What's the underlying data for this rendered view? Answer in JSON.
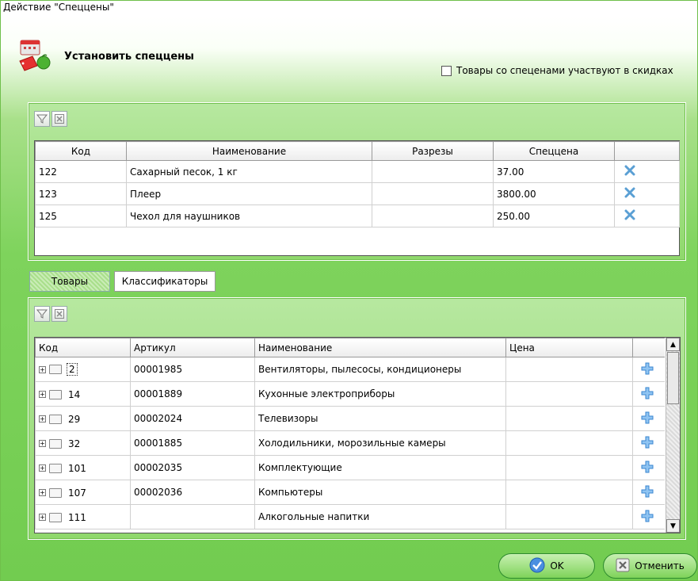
{
  "window": {
    "title": "Действие \"Спеццены\""
  },
  "header": {
    "title": "Установить спеццены"
  },
  "discount_checkbox": {
    "label": "Товары со спеценами участвуют в скидках",
    "checked": false
  },
  "top_table": {
    "columns": [
      "Код",
      "Наименование",
      "Разрезы",
      "Спеццена",
      ""
    ],
    "rows": [
      {
        "code": "122",
        "name": "Сахарный песок, 1 кг",
        "cuts": "",
        "price": "37.00"
      },
      {
        "code": "123",
        "name": "Плеер",
        "cuts": "",
        "price": "3800.00"
      },
      {
        "code": "125",
        "name": "Чехол для наушников",
        "cuts": "",
        "price": "250.00"
      }
    ]
  },
  "tabs": [
    {
      "label": "Товары",
      "active": true
    },
    {
      "label": "Классификаторы",
      "active": false
    }
  ],
  "bottom_table": {
    "columns": [
      "Код",
      "Артикул",
      "Наименование",
      "Цена",
      ""
    ],
    "rows": [
      {
        "code": "2",
        "article": "00001985",
        "name": "Вентиляторы, пылесосы, кондиционеры",
        "price": ""
      },
      {
        "code": "14",
        "article": "00001889",
        "name": "Кухонные электроприборы",
        "price": ""
      },
      {
        "code": "29",
        "article": "00002024",
        "name": "Телевизоры",
        "price": ""
      },
      {
        "code": "32",
        "article": "00001885",
        "name": "Холодильники, морозильные камеры",
        "price": ""
      },
      {
        "code": "101",
        "article": "00002035",
        "name": "Комплектующие",
        "price": ""
      },
      {
        "code": "107",
        "article": "00002036",
        "name": "Компьютеры",
        "price": ""
      },
      {
        "code": "111",
        "article": "",
        "name": "Алкогольные напитки",
        "price": ""
      }
    ]
  },
  "buttons": {
    "ok": "OK",
    "cancel": "Отменить"
  },
  "colors": {
    "accent_green": "#7ed35c",
    "delete_icon": "#5a9fd4",
    "add_icon": "#4a9be0"
  }
}
